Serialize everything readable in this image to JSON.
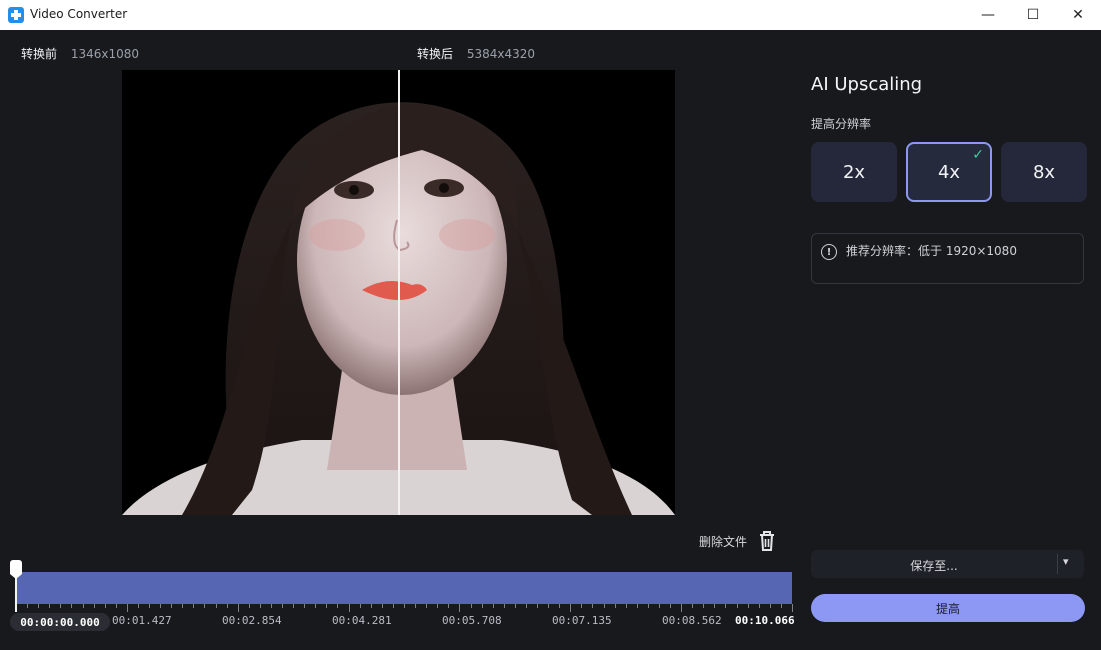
{
  "window": {
    "title": "Video Converter",
    "minimize_glyph": "—",
    "maximize_glyph": "☐",
    "close_glyph": "✕"
  },
  "compare": {
    "before_label": "转换前",
    "before_resolution": "1346x1080",
    "after_label": "转换后",
    "after_resolution": "5384x4320"
  },
  "delete_file_label": "删除文件",
  "timeline": {
    "current_time": "00:00:00.000",
    "tick_labels": [
      "00:01.427",
      "00:02.854",
      "00:04.281",
      "00:05.708",
      "00:07.135",
      "00:08.562"
    ],
    "end_time": "00:10.066",
    "track_color": "#5766b3"
  },
  "panel": {
    "title": "AI Upscaling",
    "scale_label": "提高分辨率",
    "scale_options": [
      {
        "label": "2x",
        "selected": false
      },
      {
        "label": "4x",
        "selected": true
      },
      {
        "label": "8x",
        "selected": false
      }
    ],
    "notice_text": "推荐分辨率：低于 1920×1080",
    "save_to_label": "保存至...",
    "upscale_button_label": "提高"
  },
  "colors": {
    "accent": "#8d97f4",
    "selected_border": "#8c98f2",
    "check": "#3ccf9e",
    "background": "#17191d"
  },
  "icons": {
    "app": "app-icon",
    "trash": "trash-icon",
    "info": "info-icon",
    "check": "check-icon",
    "chevron": "chevron-down-icon"
  }
}
